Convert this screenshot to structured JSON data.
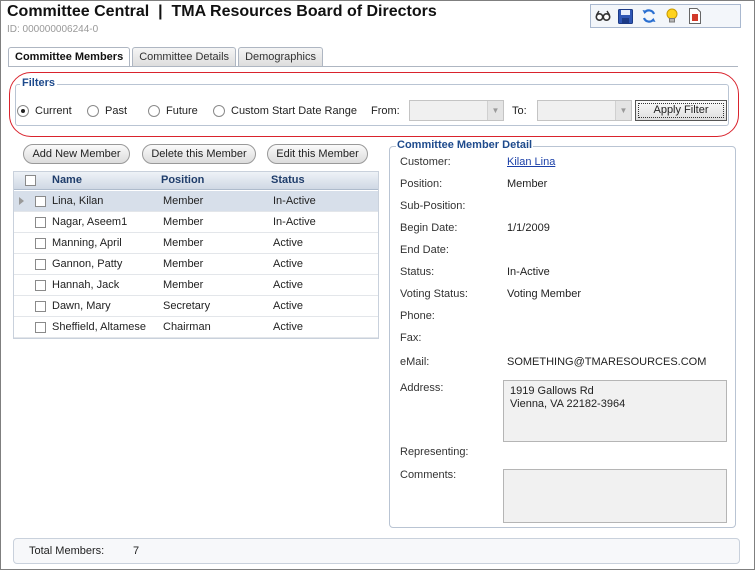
{
  "header": {
    "title": "Committee Central  |  TMA Resources Board of Directors",
    "id_text": "ID: 000000006244-0"
  },
  "toolbar": {
    "icons": [
      "glasses-icon",
      "save-icon",
      "refresh-icon",
      "lightbulb-icon",
      "report-icon"
    ]
  },
  "tabs": [
    {
      "label": "Committee Members",
      "active": true
    },
    {
      "label": "Committee Details",
      "active": false
    },
    {
      "label": "Demographics",
      "active": false
    }
  ],
  "filters": {
    "legend": "Filters",
    "options": [
      "Current",
      "Past",
      "Future",
      "Custom Start Date Range"
    ],
    "selected": "Current",
    "from_label": "From:",
    "to_label": "To:",
    "from_value": "",
    "to_value": "",
    "apply_label": "Apply Filter"
  },
  "actions": {
    "add_label": "Add New Member",
    "delete_label": "Delete this Member",
    "edit_label": "Edit this Member"
  },
  "grid": {
    "columns": [
      "Name",
      "Position",
      "Status"
    ],
    "rows": [
      {
        "name": "Lina, Kilan",
        "position": "Member",
        "status": "In-Active"
      },
      {
        "name": "Nagar, Aseem1",
        "position": "Member",
        "status": "In-Active"
      },
      {
        "name": "Manning, April",
        "position": "Member",
        "status": "Active"
      },
      {
        "name": "Gannon, Patty",
        "position": "Member",
        "status": "Active"
      },
      {
        "name": "Hannah, Jack",
        "position": "Member",
        "status": "Active"
      },
      {
        "name": "Dawn, Mary",
        "position": "Secretary",
        "status": "Active"
      },
      {
        "name": "Sheffield, Altamese",
        "position": "Chairman",
        "status": "Active"
      }
    ]
  },
  "detail": {
    "legend": "Committee Member Detail",
    "labels": {
      "customer": "Customer:",
      "position": "Position:",
      "sub_position": "Sub-Position:",
      "begin_date": "Begin Date:",
      "end_date": "End Date:",
      "status": "Status:",
      "voting_status": "Voting Status:",
      "phone": "Phone:",
      "fax": "Fax:",
      "email": "eMail:",
      "address": "Address:",
      "representing": "Representing:",
      "comments": "Comments:"
    },
    "values": {
      "customer": "Kilan Lina",
      "position": "Member",
      "sub_position": "",
      "begin_date": "1/1/2009",
      "end_date": "",
      "status": "In-Active",
      "voting_status": "Voting Member",
      "phone": "",
      "fax": "",
      "email": "SOMETHING@TMARESOURCES.COM",
      "address_line1": "1919 Gallows Rd",
      "address_line2": "Vienna, VA 22182-3964",
      "representing": "",
      "comments": ""
    }
  },
  "footer": {
    "total_label": "Total Members:",
    "total_value": "7"
  }
}
